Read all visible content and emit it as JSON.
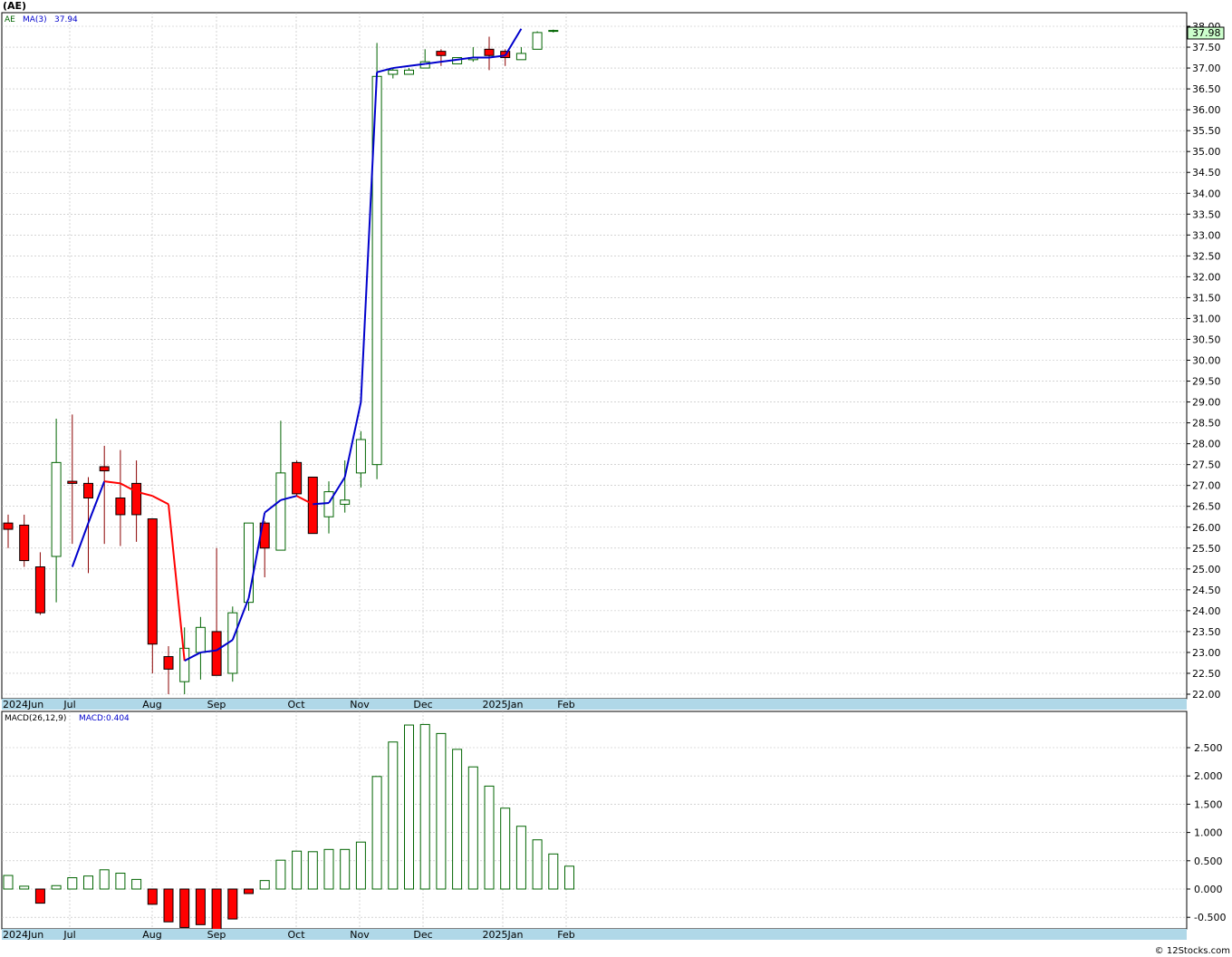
{
  "header": {
    "ticker_title": "(AE)"
  },
  "price_panel": {
    "legend_symbol": "AE",
    "legend_ma_label": "MA(3)",
    "legend_ma_value": "37.94",
    "last_price_badge": "37.98",
    "y_tick_labels": [
      "22.00",
      "22.50",
      "23.00",
      "23.50",
      "24.00",
      "24.50",
      "25.00",
      "25.50",
      "26.00",
      "26.50",
      "27.00",
      "27.50",
      "28.00",
      "28.50",
      "29.00",
      "29.50",
      "30.00",
      "30.50",
      "31.00",
      "31.50",
      "32.00",
      "32.50",
      "33.00",
      "33.50",
      "34.00",
      "34.50",
      "35.00",
      "35.50",
      "36.00",
      "36.50",
      "37.00",
      "37.50",
      "38.00"
    ]
  },
  "macd_panel": {
    "legend_label": "MACD(26,12,9)",
    "legend_value": "MACD:0.404",
    "y_tick_labels": [
      "-0.500",
      "0.000",
      "0.500",
      "1.000",
      "1.500",
      "2.000",
      "2.500"
    ]
  },
  "x_axis_labels": [
    "2024Jun",
    "Jul",
    "Aug",
    "Sep",
    "Oct",
    "Nov",
    "Dec",
    "2025Jan",
    "Feb"
  ],
  "footer": {
    "copyright": "© 12Stocks.com"
  },
  "colors": {
    "up_candle_border": "#006400",
    "down_candle_fill": "#ff0000",
    "ma_up": "#0000cc",
    "ma_down": "#ff0000",
    "macd_up_border": "#006400",
    "macd_down_fill": "#ff0000",
    "axis_strip": "#b0d8e8",
    "badge_fill": "#ccffcc",
    "grid": "#bbbbbb"
  },
  "chart_data": [
    {
      "type": "candlestick",
      "title": "(AE)",
      "interval": "weekly",
      "ylim": [
        22.0,
        38.0
      ],
      "grid": true,
      "x": [
        "2024-06-03",
        "2024-06-10",
        "2024-06-17",
        "2024-06-24",
        "2024-07-01",
        "2024-07-08",
        "2024-07-15",
        "2024-07-22",
        "2024-07-29",
        "2024-08-05",
        "2024-08-12",
        "2024-08-19",
        "2024-08-26",
        "2024-09-02",
        "2024-09-09",
        "2024-09-16",
        "2024-09-23",
        "2024-09-30",
        "2024-10-07",
        "2024-10-14",
        "2024-10-21",
        "2024-10-28",
        "2024-11-04",
        "2024-11-11",
        "2024-11-18",
        "2024-11-25",
        "2024-12-02",
        "2024-12-09",
        "2024-12-16",
        "2024-12-23",
        "2024-12-30",
        "2025-01-06",
        "2025-01-13",
        "2025-01-20",
        "2025-01-27"
      ],
      "open": [
        26.1,
        26.05,
        25.05,
        25.3,
        27.1,
        27.05,
        27.45,
        26.7,
        27.05,
        26.2,
        22.9,
        22.3,
        23.0,
        23.5,
        22.5,
        24.2,
        26.1,
        25.45,
        27.55,
        27.2,
        26.25,
        26.55,
        27.3,
        27.5,
        36.85,
        36.85,
        37.0,
        37.4,
        37.1,
        37.2,
        37.45,
        37.4,
        37.2,
        37.45,
        37.88
      ],
      "high": [
        26.3,
        26.3,
        25.4,
        28.6,
        28.7,
        27.2,
        27.95,
        27.85,
        27.6,
        26.2,
        23.15,
        23.6,
        23.85,
        25.5,
        24.1,
        26.1,
        26.15,
        28.55,
        27.6,
        27.2,
        27.1,
        27.6,
        28.3,
        37.6,
        37.0,
        37.0,
        37.45,
        37.45,
        37.25,
        37.5,
        37.75,
        37.45,
        37.5,
        37.88,
        37.92
      ],
      "low": [
        25.5,
        25.05,
        23.9,
        24.2,
        25.6,
        24.9,
        25.6,
        25.55,
        25.65,
        22.5,
        22.0,
        22.0,
        22.35,
        22.5,
        22.3,
        24.0,
        24.8,
        25.45,
        26.75,
        25.85,
        25.85,
        26.35,
        26.95,
        27.15,
        36.75,
        36.85,
        37.0,
        37.05,
        37.1,
        37.15,
        36.95,
        37.05,
        37.2,
        37.45,
        37.85
      ],
      "close": [
        25.95,
        25.2,
        23.95,
        27.55,
        27.05,
        26.7,
        27.35,
        26.3,
        26.3,
        23.2,
        22.6,
        23.1,
        23.6,
        22.45,
        23.95,
        26.1,
        25.5,
        27.3,
        26.8,
        25.85,
        26.85,
        26.65,
        28.1,
        36.8,
        36.95,
        36.95,
        37.15,
        37.3,
        37.25,
        37.25,
        37.3,
        37.25,
        37.35,
        37.85,
        37.9
      ],
      "ma": [
        null,
        null,
        25.05,
        26.1,
        27.1,
        27.05,
        26.85,
        26.75,
        26.55,
        22.8,
        23.0,
        23.05,
        23.3,
        24.3,
        26.35,
        26.65,
        26.75,
        26.55,
        26.58,
        27.2,
        29.0,
        36.9,
        37.0,
        37.05,
        37.1,
        37.15,
        37.2,
        37.25,
        37.25,
        37.3,
        37.94
      ],
      "ma_x_offset": 2,
      "legend": [
        "AE",
        "MA(3)"
      ]
    },
    {
      "type": "bar",
      "title": "MACD(26,12,9)",
      "ylim": [
        -0.6,
        2.9
      ],
      "grid": true,
      "x": [
        "2024-06-03",
        "2024-06-10",
        "2024-06-17",
        "2024-06-24",
        "2024-07-01",
        "2024-07-08",
        "2024-07-15",
        "2024-07-22",
        "2024-07-29",
        "2024-08-05",
        "2024-08-12",
        "2024-08-19",
        "2024-08-26",
        "2024-09-02",
        "2024-09-09",
        "2024-09-16",
        "2024-09-23",
        "2024-09-30",
        "2024-10-07",
        "2024-10-14",
        "2024-10-21",
        "2024-10-28",
        "2024-11-04",
        "2024-11-11",
        "2024-11-18",
        "2024-11-25",
        "2024-12-02",
        "2024-12-09",
        "2024-12-16",
        "2024-12-23",
        "2024-12-30",
        "2025-01-06",
        "2025-01-13",
        "2025-01-20",
        "2025-01-27"
      ],
      "values": [
        0.24,
        0.05,
        -0.25,
        0.06,
        0.2,
        0.23,
        0.34,
        0.28,
        0.17,
        -0.27,
        -0.58,
        -0.68,
        -0.63,
        -0.72,
        -0.53,
        -0.08,
        0.15,
        0.51,
        0.67,
        0.66,
        0.7,
        0.7,
        0.83,
        1.99,
        2.6,
        2.9,
        2.91,
        2.75,
        2.47,
        2.16,
        1.82,
        1.43,
        1.11,
        0.87,
        0.62,
        0.404
      ]
    }
  ]
}
